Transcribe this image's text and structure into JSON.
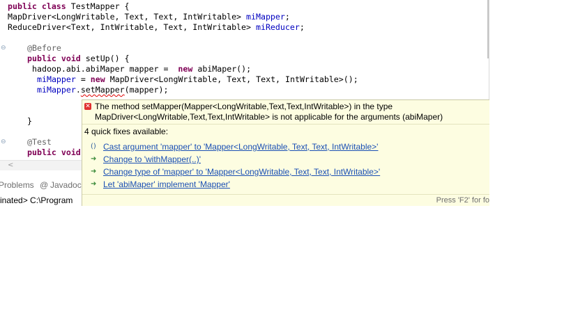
{
  "editor": {
    "line1": {
      "kw": "public class",
      "name": " TestMapper {"
    },
    "line2": {
      "type": "MapDriver<LongWritable, Text, Text, IntWritable> ",
      "field": "miMapper",
      "end": ";"
    },
    "line3": {
      "type": "ReduceDriver<Text, IntWritable, Text, IntWritable> ",
      "field": "miReducer",
      "end": ";"
    },
    "line4": {
      "annotation": "@Before"
    },
    "line5": {
      "kw": "public void",
      "rest": " setUp() {"
    },
    "line6": {
      "pre": "hadoop.abi.abiMaper mapper =  ",
      "kw": "new",
      "post": " abiMaper();"
    },
    "line7": {
      "field": "miMapper",
      "eq": " = ",
      "kw": "new",
      "post": " MapDriver<LongWritable, Text, Text, IntWritable>();"
    },
    "line8": {
      "field": "miMapper",
      "dot": ".",
      "method": "setMapper",
      "post": "(mapper);"
    },
    "line9": {
      "text": "}"
    },
    "line10": {
      "annotation": "@Test"
    },
    "line11": {
      "kw": "public void"
    }
  },
  "bottom_panel": {
    "tabs": [
      "Problems",
      "Javadoc"
    ],
    "console_text": "inated> C:\\Program"
  },
  "hover": {
    "message_line1": "The method setMapper(Mapper<LongWritable,Text,Text,IntWritable>) in the type",
    "message_line2": "MapDriver<LongWritable,Text,Text,IntWritable> is not applicable for the arguments (abiMaper)",
    "quick_fix_count": "4 quick fixes available:",
    "fixes": [
      "Cast argument 'mapper' to 'Mapper<LongWritable, Text, Text, IntWritable>'",
      "Change to 'withMapper(..)'",
      "Change type of 'mapper' to 'Mapper<LongWritable, Text, Text, IntWritable>'",
      "Let 'abiMaper' implement 'Mapper'"
    ],
    "footer_hint": "Press 'F2' for fo"
  },
  "colors": {
    "keyword": "#7f0055",
    "field": "#0000c0",
    "annotation": "#646464",
    "link": "#1a4fb4",
    "hover_bg": "#fdfde1"
  },
  "icons": [
    "collapse-icon",
    "error-icon",
    "cast-fix-icon",
    "quick-fix-icon",
    "scroll-left-icon"
  ]
}
